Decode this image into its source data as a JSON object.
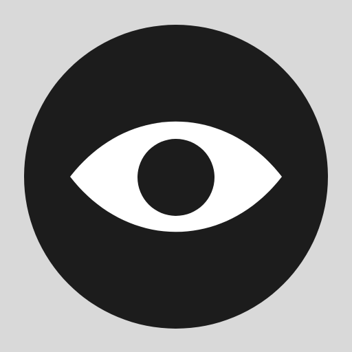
{
  "icon": {
    "name": "eye-icon",
    "colors": {
      "background": "#d9d9d9",
      "circle": "#1c1c1c",
      "eye_white": "#ffffff",
      "pupil": "#1c1c1c"
    }
  }
}
